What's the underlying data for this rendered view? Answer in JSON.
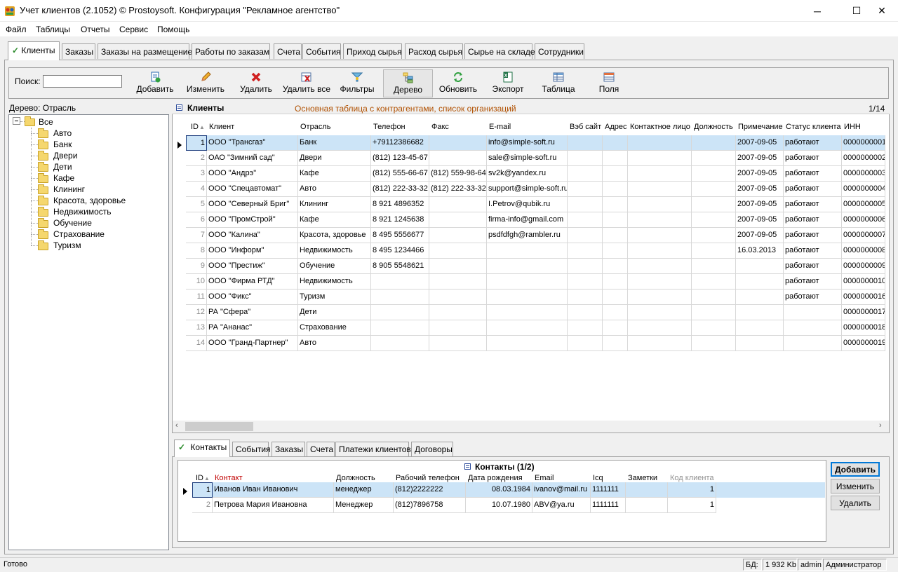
{
  "window": {
    "title": "Учет клиентов (2.1052) © Prostoysoft. Конфигурация \"Рекламное агентство\"",
    "minimize": "─",
    "maximize": "☐",
    "close": "✕"
  },
  "menu": [
    "Файл",
    "Таблицы",
    "Отчеты",
    "Сервис",
    "Помощь"
  ],
  "tabs": [
    "Клиенты",
    "Заказы",
    "Заказы на размещение",
    "Работы по заказам",
    "Счета",
    "События",
    "Приход сырья",
    "Расход сырья",
    "Сырье на складе",
    "Сотрудники"
  ],
  "toolbar": {
    "search_label": "Поиск:",
    "search_value": "",
    "buttons": [
      "Добавить",
      "Изменить",
      "Удалить",
      "Удалить все",
      "Фильтры",
      "Дерево",
      "Обновить",
      "Экспорт",
      "Таблица",
      "Поля"
    ],
    "icons": [
      "add-doc-icon",
      "pencil-icon",
      "red-x-icon",
      "delete-all-icon",
      "filter-icon",
      "tree-icon",
      "refresh-icon",
      "excel-icon",
      "table-icon",
      "fields-icon"
    ]
  },
  "tree": {
    "label": "Дерево: Отрасль",
    "root": "Все",
    "expander": "⊟",
    "items": [
      "Авто",
      "Банк",
      "Двери",
      "Дети",
      "Кафе",
      "Клининг",
      "Красота, здоровье",
      "Недвижимость",
      "Обучение",
      "Страхование",
      "Туризм"
    ]
  },
  "grid": {
    "title": "Клиенты",
    "description": "Основная таблица с контрагентами, список организаций",
    "count": "1/14",
    "sort_glyph": "▲",
    "columns": [
      "ID",
      "Клиент",
      "Отрасль",
      "Телефон",
      "Факс",
      "E-mail",
      "Вэб сайт",
      "Адрес",
      "Контактное лицо",
      "Должность",
      "Примечание",
      "Статус клиента",
      "ИНН"
    ],
    "rows": [
      [
        "1",
        "ООО \"Трансгаз\"",
        "Банк",
        "+79112386682",
        "",
        "info@simple-soft.ru",
        "",
        "",
        "",
        "",
        "2007-09-05",
        "работают",
        "0000000001"
      ],
      [
        "2",
        "ОАО \"Зимний сад\"",
        "Двери",
        "(812) 123-45-67",
        "",
        "sale@simple-soft.ru",
        "",
        "",
        "",
        "",
        "2007-09-05",
        "работают",
        "0000000002"
      ],
      [
        "3",
        "ООО \"Андрэ\"",
        "Кафе",
        "(812) 555-66-67",
        "(812) 559-98-64",
        "sv2k@yandex.ru",
        "",
        "",
        "",
        "",
        "2007-09-05",
        "работают",
        "0000000003"
      ],
      [
        "4",
        "ООО \"Спецавтомат\"",
        "Авто",
        "(812) 222-33-32",
        "(812) 222-33-32",
        "support@simple-soft.ru",
        "",
        "",
        "",
        "",
        "2007-09-05",
        "работают",
        "0000000004"
      ],
      [
        "5",
        "ООО \"Северный Бриг\"",
        "Клининг",
        "8 921 4896352",
        "",
        "I.Petrov@qubik.ru",
        "",
        "",
        "",
        "",
        "2007-09-05",
        "работают",
        "0000000005"
      ],
      [
        "6",
        "ООО \"ПромСтрой\"",
        "Кафе",
        "8 921 1245638",
        "",
        "firma-info@gmail.com",
        "",
        "",
        "",
        "",
        "2007-09-05",
        "работают",
        "0000000006"
      ],
      [
        "7",
        "ООО \"Калина\"",
        "Красота, здоровье",
        "8 495 5556677",
        "",
        "psdfdfgh@rambler.ru",
        "",
        "",
        "",
        "",
        "2007-09-05",
        "работают",
        "0000000007"
      ],
      [
        "8",
        "ООО \"Информ\"",
        "Недвижимость",
        "8 495 1234466",
        "",
        "",
        "",
        "",
        "",
        "",
        "16.03.2013",
        "работают",
        "0000000008"
      ],
      [
        "9",
        "ООО \"Престиж\"",
        "Обучение",
        "8 905 5548621",
        "",
        "",
        "",
        "",
        "",
        "",
        "",
        "работают",
        "0000000009"
      ],
      [
        "10",
        "ООО \"Фирма РТД\"",
        "Недвижимость",
        "",
        "",
        "",
        "",
        "",
        "",
        "",
        "",
        "работают",
        "0000000010"
      ],
      [
        "11",
        "ООО \"Фикс\"",
        "Туризм",
        "",
        "",
        "",
        "",
        "",
        "",
        "",
        "",
        "работают",
        "0000000016"
      ],
      [
        "12",
        "РА \"Сфера\"",
        "Дети",
        "",
        "",
        "",
        "",
        "",
        "",
        "",
        "",
        "",
        "0000000017"
      ],
      [
        "13",
        "РА \"Ананас\"",
        "Страхование",
        "",
        "",
        "",
        "",
        "",
        "",
        "",
        "",
        "",
        "0000000018"
      ],
      [
        "14",
        "ООО \"Гранд-Партнер\"",
        "Авто",
        "",
        "",
        "",
        "",
        "",
        "",
        "",
        "",
        "",
        "0000000019"
      ]
    ]
  },
  "bottom_tabs": [
    "Контакты",
    "События",
    "Заказы",
    "Счета",
    "Платежи клиентов",
    "Договоры"
  ],
  "contacts": {
    "title": "Контакты (1/2)",
    "columns": [
      "ID",
      "Контакт",
      "Должность",
      "Рабочий телефон",
      "Дата рождения",
      "Email",
      "Icq",
      "Заметки",
      "Код клиента"
    ],
    "rows": [
      [
        "1",
        "Иванов Иван Иванович",
        "менеджер",
        "(812)2222222",
        "08.03.1984",
        "ivanov@mail.ru",
        "1111111",
        "",
        "1"
      ],
      [
        "2",
        "Петрова Мария Ивановна",
        "Менеджер",
        "(812)7896758",
        "10.07.1980",
        "ABV@ya.ru",
        "1111111",
        "",
        "1"
      ]
    ],
    "buttons": [
      "Добавить",
      "Изменить",
      "Удалить"
    ]
  },
  "status": {
    "text": "Готово",
    "db_label": "БД:",
    "db_size": "1 932 Kb",
    "user": "admin",
    "role": "Администратор"
  },
  "colors": {
    "selected_row": "#cce4f7",
    "desc_text": "#b05000",
    "contact_header": "#c00000"
  }
}
